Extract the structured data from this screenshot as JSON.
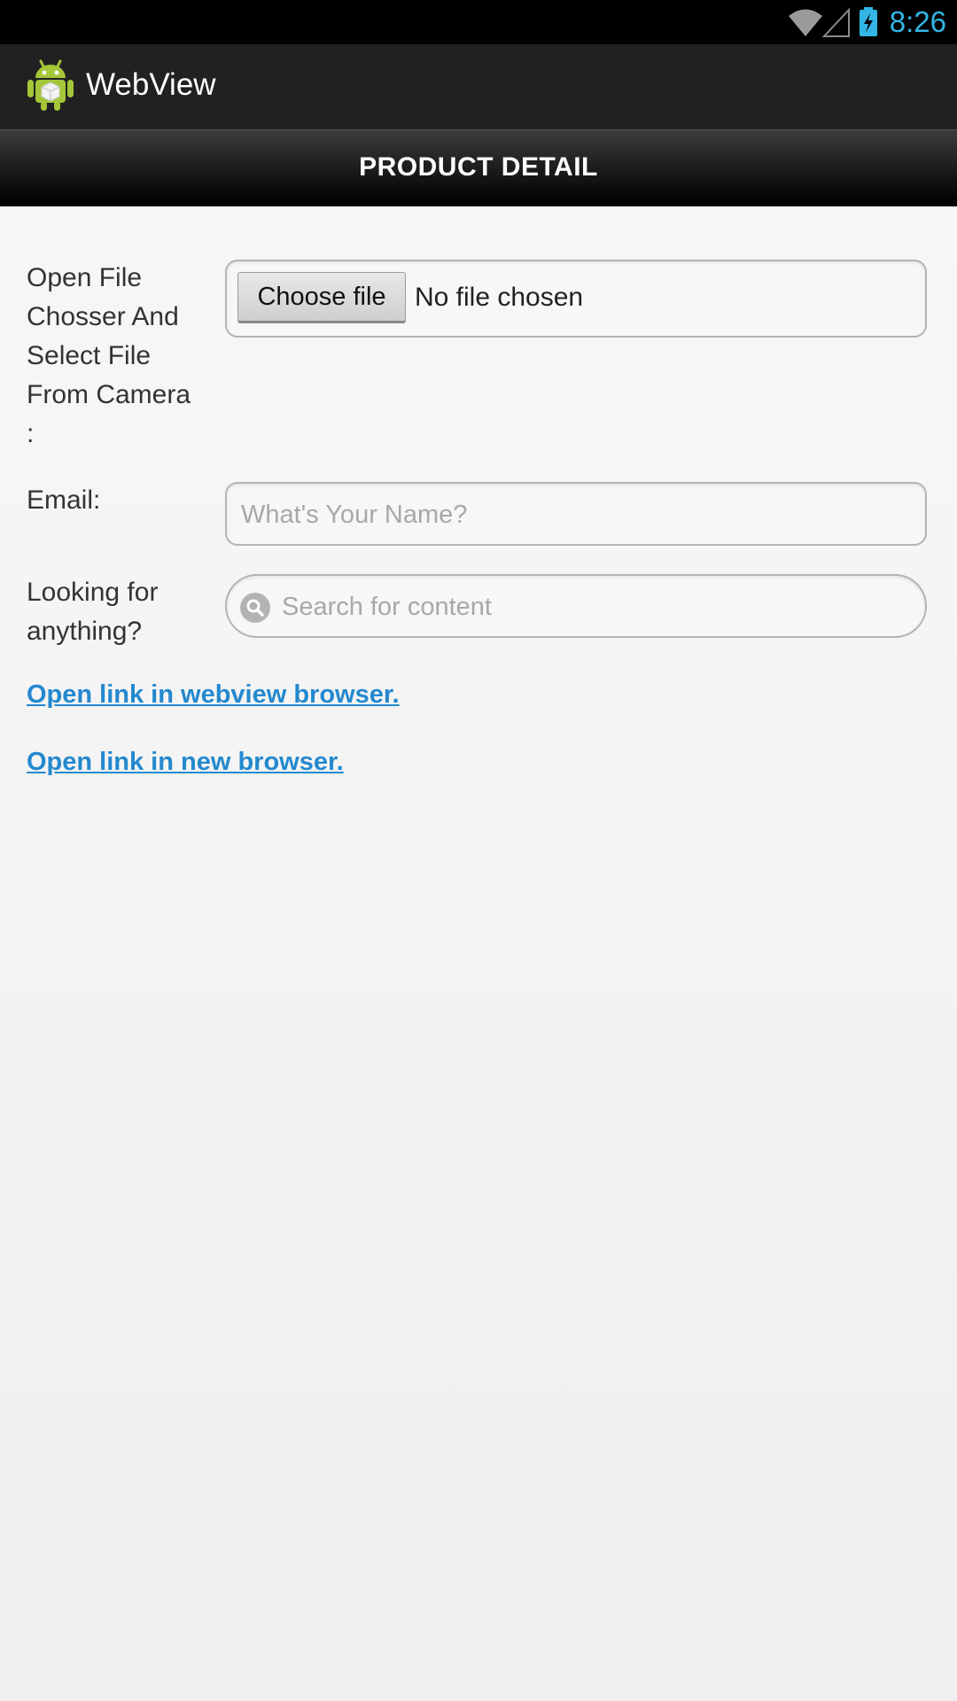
{
  "status_bar": {
    "time": "8:26",
    "icons": [
      "wifi-icon",
      "cell-signal-icon",
      "battery-charging-icon"
    ]
  },
  "action_bar": {
    "app_icon": "android-app-icon",
    "title": "WebView"
  },
  "page": {
    "header_title": "PRODUCT DETAIL"
  },
  "form": {
    "file_label_lines": [
      "Open File",
      "Chosser And",
      "Select File",
      "From Camera",
      ":"
    ],
    "choose_file_label": "Choose file",
    "no_file_text": "No file chosen",
    "email_label": "Email:",
    "email_placeholder": "What's Your Name?",
    "search_label_lines": [
      "Looking for",
      "anything?"
    ],
    "search_placeholder": "Search for content",
    "search_icon": "search-icon"
  },
  "links": {
    "webview_link": "Open link in webview browser.",
    "new_browser_link": "Open link in new browser."
  },
  "colors": {
    "clock": "#33b5e5",
    "action_bar_bg": "#212121",
    "link": "#2489ce",
    "android_green": "#a4c639"
  }
}
